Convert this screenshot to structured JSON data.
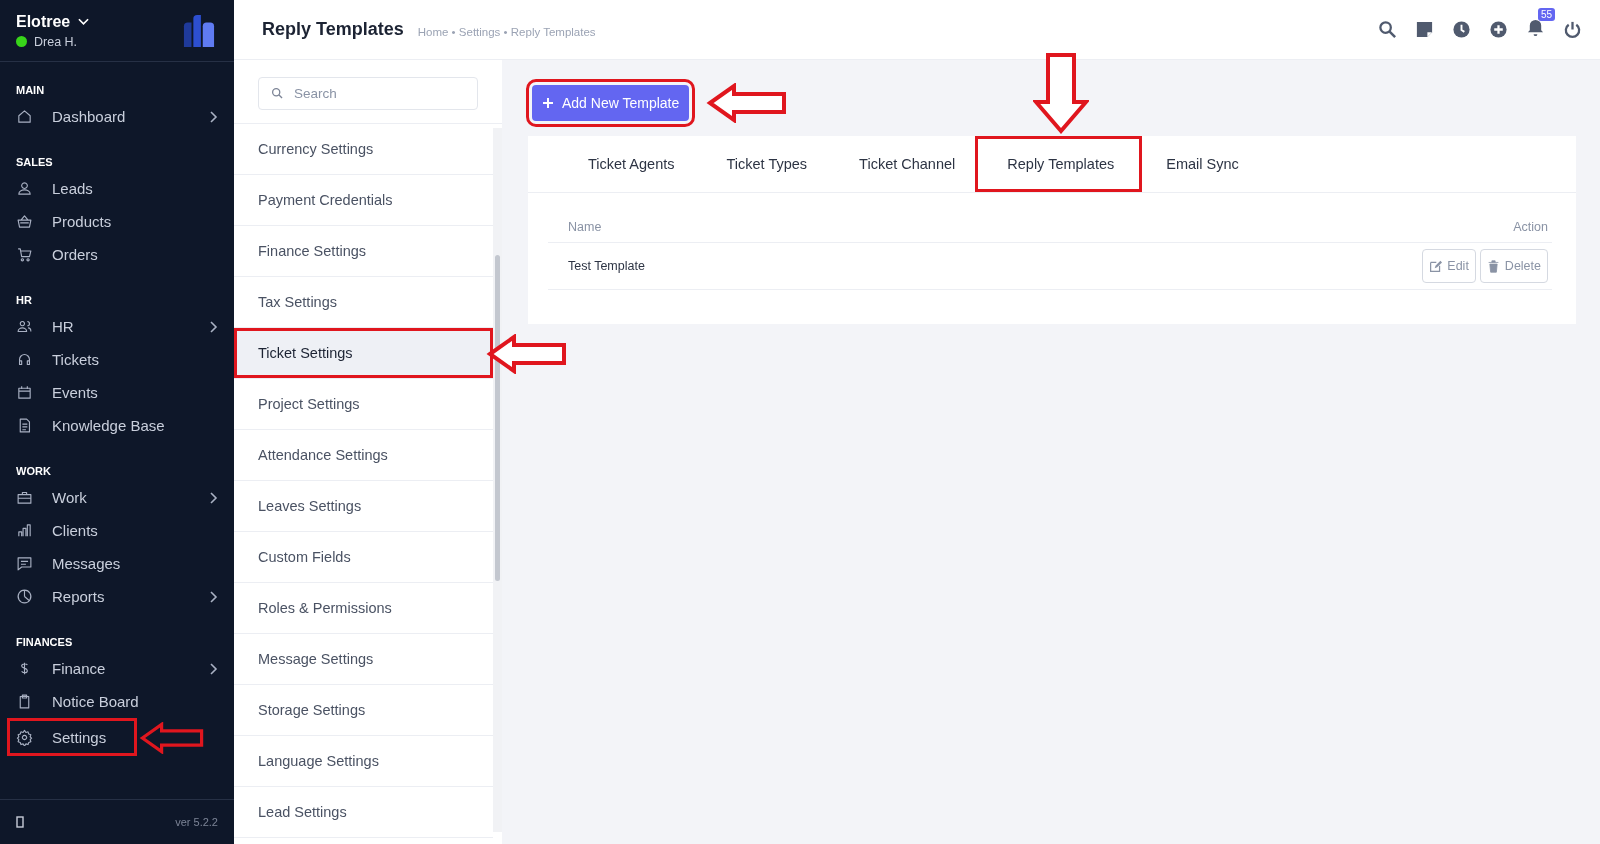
{
  "sidebar": {
    "brand": "Elotree",
    "user": {
      "name": "Drea H.",
      "online": true
    },
    "sections": [
      {
        "title": "MAIN",
        "items": [
          {
            "label": "Dashboard",
            "has_submenu": true,
            "callout": false
          }
        ]
      },
      {
        "title": "SALES",
        "items": [
          {
            "label": "Leads",
            "has_submenu": false,
            "callout": false
          },
          {
            "label": "Products",
            "has_submenu": false,
            "callout": false
          },
          {
            "label": "Orders",
            "has_submenu": false,
            "callout": false
          }
        ]
      },
      {
        "title": "HR",
        "items": [
          {
            "label": "HR",
            "has_submenu": true,
            "callout": false
          },
          {
            "label": "Tickets",
            "has_submenu": false,
            "callout": false
          },
          {
            "label": "Events",
            "has_submenu": false,
            "callout": false
          },
          {
            "label": "Knowledge Base",
            "has_submenu": false,
            "callout": false
          }
        ]
      },
      {
        "title": "WORK",
        "items": [
          {
            "label": "Work",
            "has_submenu": true,
            "callout": false
          },
          {
            "label": "Clients",
            "has_submenu": false,
            "callout": false
          },
          {
            "label": "Messages",
            "has_submenu": false,
            "callout": false
          },
          {
            "label": "Reports",
            "has_submenu": true,
            "callout": false
          }
        ]
      },
      {
        "title": "FINANCES",
        "items": [
          {
            "label": "Finance",
            "has_submenu": true,
            "callout": false
          },
          {
            "label": "Notice Board",
            "has_submenu": false,
            "callout": false
          },
          {
            "label": "Settings",
            "has_submenu": false,
            "callout": true
          }
        ]
      }
    ],
    "version": "ver 5.2.2"
  },
  "header": {
    "title": "Reply Templates",
    "breadcrumb": "Home • Settings • Reply Templates",
    "notification_count": "55"
  },
  "settings_menu": {
    "search_placeholder": "Search",
    "items": [
      {
        "label": "Currency Settings",
        "selected": false,
        "callout": false
      },
      {
        "label": "Payment Credentials",
        "selected": false,
        "callout": false
      },
      {
        "label": "Finance Settings",
        "selected": false,
        "callout": false
      },
      {
        "label": "Tax Settings",
        "selected": false,
        "callout": false
      },
      {
        "label": "Ticket Settings",
        "selected": true,
        "callout": true
      },
      {
        "label": "Project Settings",
        "selected": false,
        "callout": false
      },
      {
        "label": "Attendance Settings",
        "selected": false,
        "callout": false
      },
      {
        "label": "Leaves Settings",
        "selected": false,
        "callout": false
      },
      {
        "label": "Custom Fields",
        "selected": false,
        "callout": false
      },
      {
        "label": "Roles & Permissions",
        "selected": false,
        "callout": false
      },
      {
        "label": "Message Settings",
        "selected": false,
        "callout": false
      },
      {
        "label": "Storage Settings",
        "selected": false,
        "callout": false
      },
      {
        "label": "Language Settings",
        "selected": false,
        "callout": false
      },
      {
        "label": "Lead Settings",
        "selected": false,
        "callout": false
      }
    ]
  },
  "add_button": {
    "label": "Add New Template",
    "callout": true
  },
  "tabs": [
    {
      "label": "Ticket Agents",
      "callout": false
    },
    {
      "label": "Ticket Types",
      "callout": false
    },
    {
      "label": "Ticket Channel",
      "callout": false
    },
    {
      "label": "Reply Templates",
      "callout": true
    },
    {
      "label": "Email Sync",
      "callout": false
    }
  ],
  "table": {
    "columns": [
      "Name",
      "Action"
    ],
    "rows": [
      {
        "name": "Test Template",
        "edit": "Edit",
        "delete": "Delete"
      }
    ]
  }
}
